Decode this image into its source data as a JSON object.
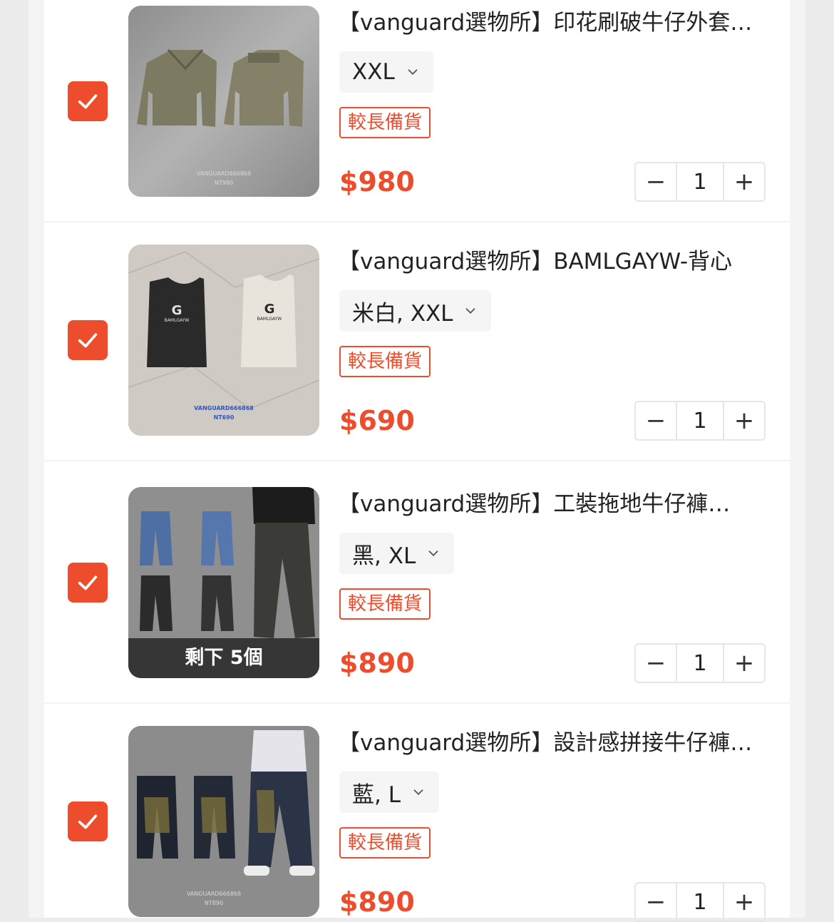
{
  "cart": {
    "items": [
      {
        "title": "【vanguard選物所】印花刷破牛仔外套…",
        "variant": "XXL",
        "badge": "較長備貨",
        "price": "$980",
        "quantity": "1",
        "selected": true,
        "stock_note": "",
        "image": {
          "name": "jacket-product-image",
          "watermark": "VANGUARD666868 NT980"
        }
      },
      {
        "title": "【vanguard選物所】BAMLGAYW-背心",
        "variant": "米白, XXL",
        "badge": "較長備貨",
        "price": "$690",
        "quantity": "1",
        "selected": true,
        "stock_note": "",
        "image": {
          "name": "vest-product-image",
          "watermark": "VANGUARD666868 NT690"
        }
      },
      {
        "title": "【vanguard選物所】工裝拖地牛仔褲…",
        "variant": "黑, XL",
        "badge": "較長備貨",
        "price": "$890",
        "quantity": "1",
        "selected": true,
        "stock_note": "剩下 5個",
        "image": {
          "name": "cargo-jeans-product-image",
          "watermark": ""
        }
      },
      {
        "title": "【vanguard選物所】設計感拼接牛仔褲…",
        "variant": "藍, L",
        "badge": "較長備貨",
        "price": "$890",
        "quantity": "1",
        "selected": true,
        "stock_note": "",
        "image": {
          "name": "patchwork-jeans-product-image",
          "watermark": "VANGUARD666868 NT890"
        }
      }
    ],
    "stepper": {
      "minus": "−",
      "plus": "+"
    }
  },
  "colors": {
    "accent": "#ee4d2d",
    "panel": "#ffffff",
    "background": "#ececec"
  },
  "icons": [
    "check-icon",
    "chevron-down-icon",
    "minus-icon",
    "plus-icon"
  ]
}
